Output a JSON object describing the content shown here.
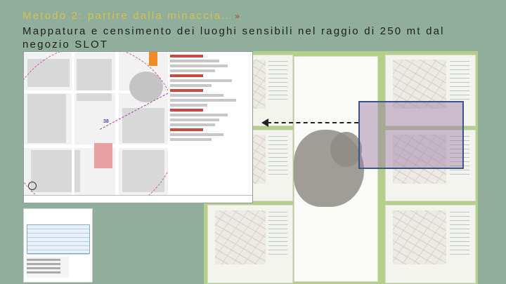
{
  "title_line1": "Metodo 2: partire dalla minaccia…",
  "title_chevron": "»",
  "title_line2": "Mappatura e censimento dei luoghi sensibili nel raggio di 250 mt dal negozio SLOT",
  "map": {
    "marker_label": "38"
  },
  "colors": {
    "background": "#8fae9c",
    "title_accent": "#d9c04a",
    "highlight_border": "#3a5490",
    "green_panel": "#b3cf8a"
  }
}
